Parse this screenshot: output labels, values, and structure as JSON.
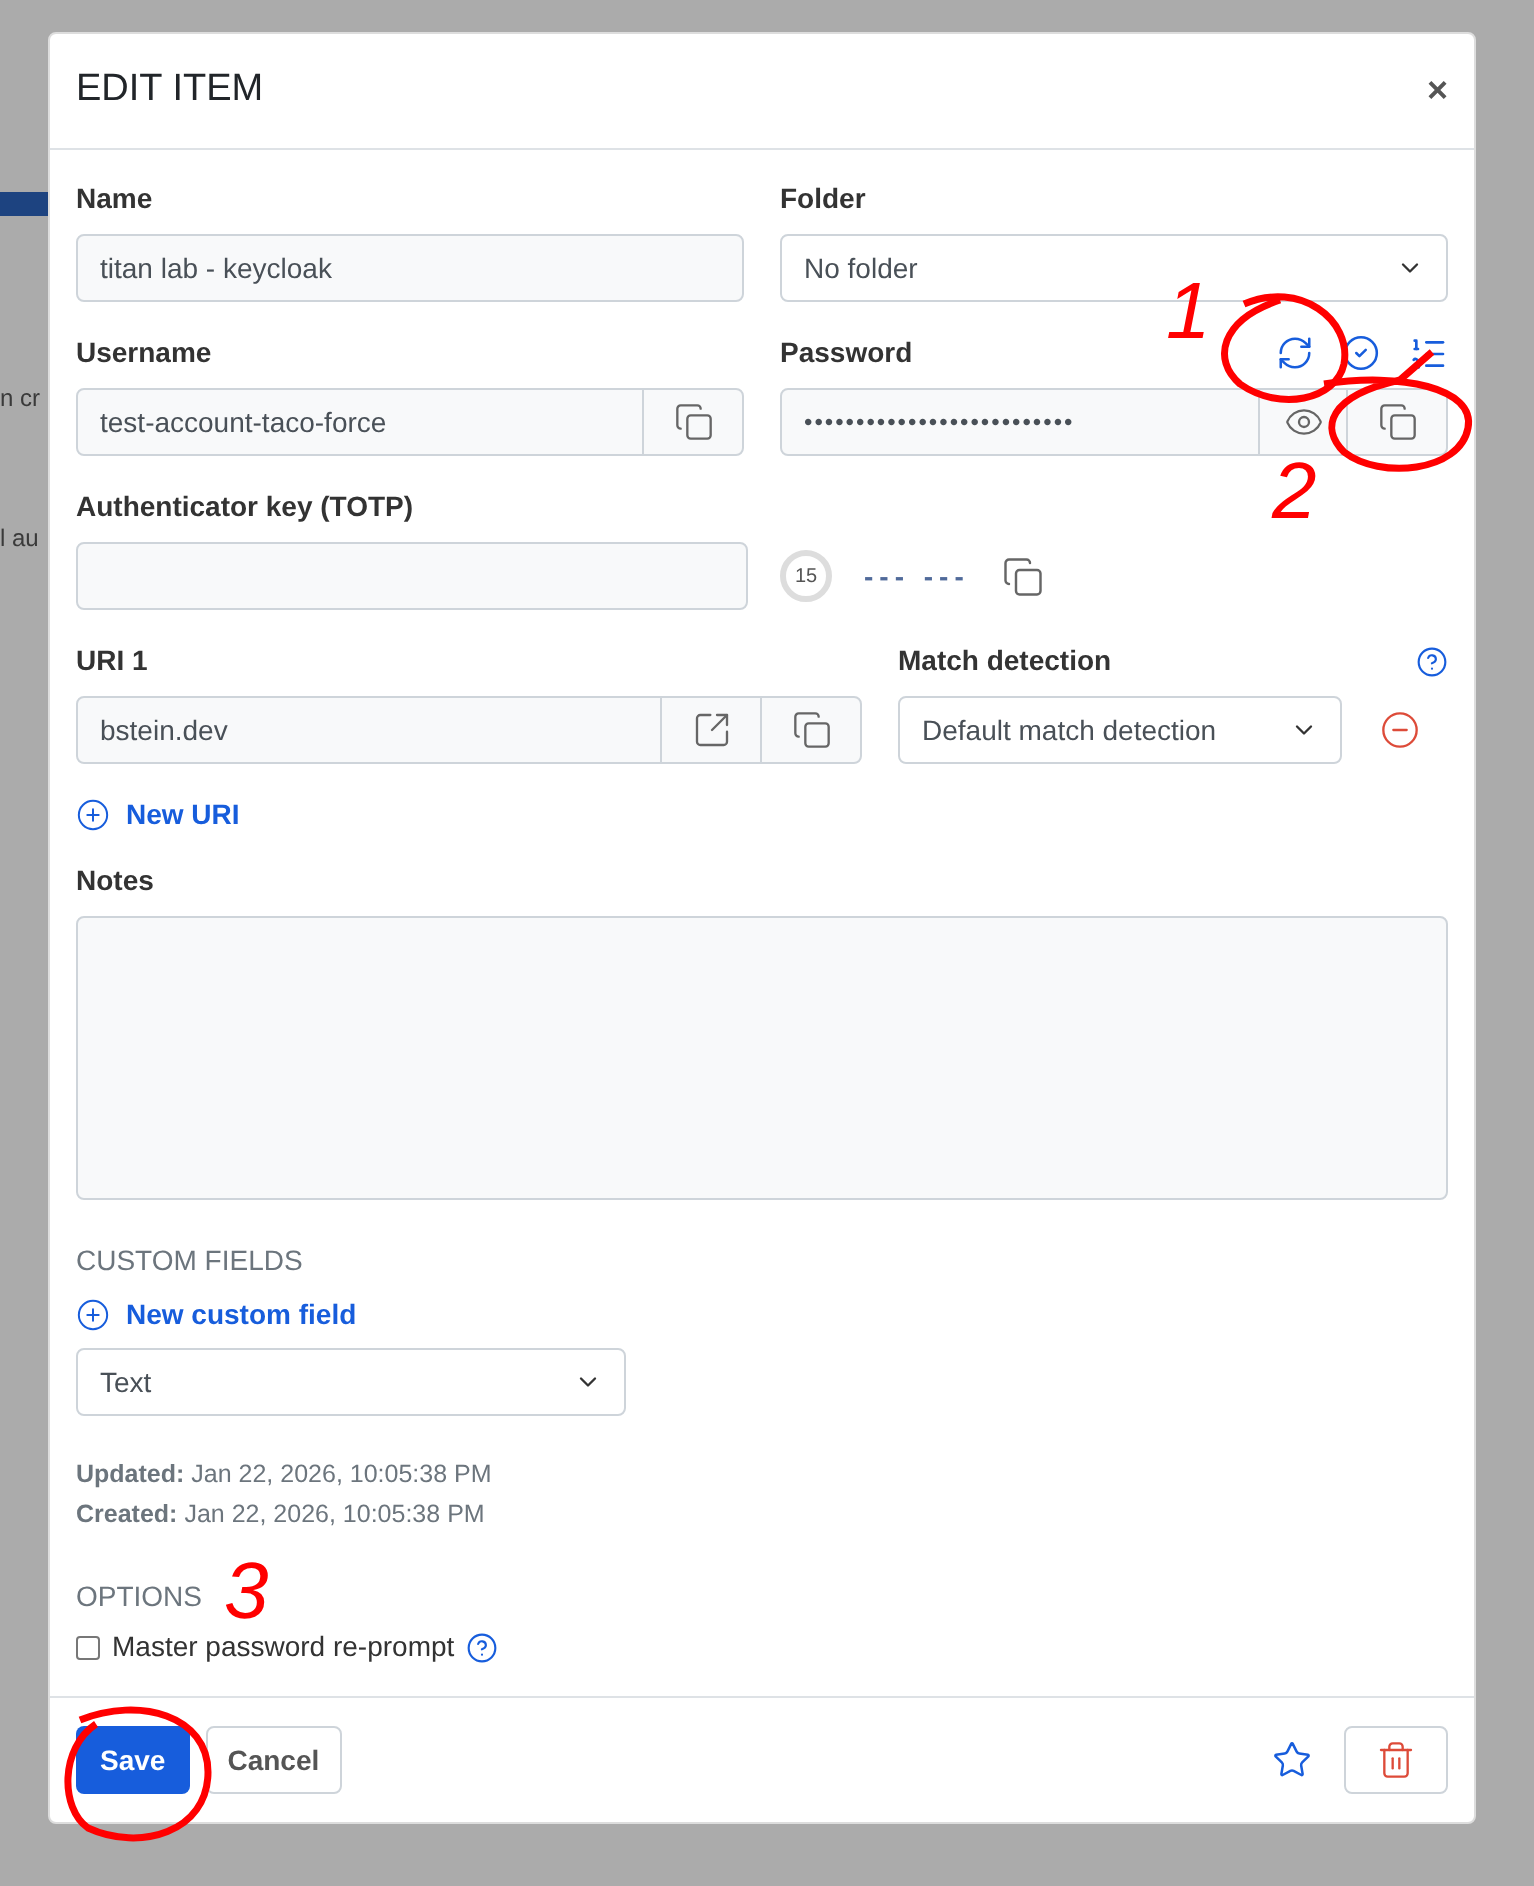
{
  "background": {
    "fragments": [
      "n cr",
      "l au"
    ]
  },
  "dialog": {
    "title": "EDIT ITEM",
    "close": "×"
  },
  "name": {
    "label": "Name",
    "value": "titan lab - keycloak"
  },
  "folder": {
    "label": "Folder",
    "value": "No folder"
  },
  "username": {
    "label": "Username",
    "value": "test-account-taco-force"
  },
  "password": {
    "label": "Password",
    "masked_value": "••••••••••••••••••••••••••"
  },
  "totp": {
    "label": "Authenticator key (TOTP)",
    "timer": "15",
    "code": "--- ---"
  },
  "uri": {
    "label": "URI 1",
    "value": "bstein.dev"
  },
  "match": {
    "label": "Match detection",
    "value": "Default match detection"
  },
  "new_uri": "New URI",
  "notes": {
    "label": "Notes"
  },
  "custom_fields": {
    "heading": "CUSTOM FIELDS",
    "add": "New custom field",
    "type_value": "Text"
  },
  "meta": [
    {
      "label": "Updated:",
      "value": "Jan 22, 2026, 10:05:38 PM"
    },
    {
      "label": "Created:",
      "value": "Jan 22, 2026, 10:05:38 PM"
    }
  ],
  "options": {
    "heading": "OPTIONS",
    "reprompt": {
      "label": "Master password re-prompt",
      "checked": false
    }
  },
  "footer": {
    "save": "Save",
    "cancel": "Cancel"
  },
  "annotations": [
    {
      "label": "1"
    },
    {
      "label": "2"
    },
    {
      "label": "3"
    }
  ]
}
